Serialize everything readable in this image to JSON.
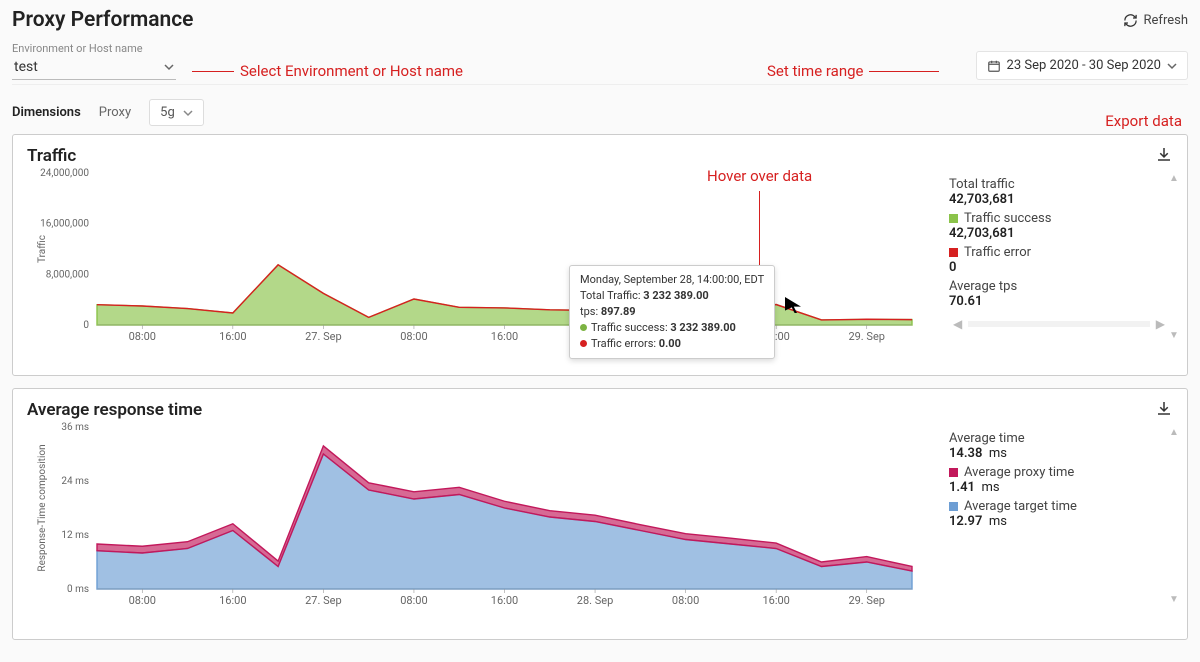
{
  "page_title": "Proxy Performance",
  "refresh_label": "Refresh",
  "env_selector": {
    "label": "Environment or Host name",
    "value": "test"
  },
  "date_range": "23 Sep 2020 - 30 Sep 2020",
  "dimensions": {
    "label": "Dimensions",
    "name": "Proxy",
    "value": "5g"
  },
  "callouts": {
    "env": "Select Environment or Host name",
    "date": "Set time range",
    "export": "Export data",
    "hover": "Hover over data"
  },
  "traffic_panel": {
    "title": "Traffic",
    "legend": {
      "total_label": "Total traffic",
      "total_value": "42,703,681",
      "success_label": "Traffic success",
      "success_value": "42,703,681",
      "error_label": "Traffic error",
      "error_value": "0",
      "avg_tps_label": "Average tps",
      "avg_tps_value": "70.61"
    },
    "tooltip": {
      "time": "Monday, September 28, 14:00:00, EDT",
      "total_label": "Total Traffic:",
      "total_value": "3 232 389.00",
      "tps_label": "tps:",
      "tps_value": "897.89",
      "success_label": "Traffic success:",
      "success_value": "3 232 389.00",
      "errors_label": "Traffic errors:",
      "errors_value": "0.00"
    }
  },
  "response_panel": {
    "title": "Average response time",
    "legend": {
      "avg_label": "Average time",
      "avg_value": "14.38",
      "avg_unit": "ms",
      "proxy_label": "Average proxy time",
      "proxy_value": "1.41",
      "proxy_unit": "ms",
      "target_label": "Average target time",
      "target_value": "12.97",
      "target_unit": "ms"
    }
  },
  "x_ticks": [
    "08:00",
    "16:00",
    "27. Sep",
    "08:00",
    "16:00",
    "28. Sep",
    "08:00",
    "16:00",
    "29. Sep"
  ],
  "chart_data": [
    {
      "type": "area",
      "title": "Traffic",
      "ylabel": "Traffic",
      "ylim": [
        0,
        24000000
      ],
      "y_ticks": [
        0,
        8000000,
        16000000,
        24000000
      ],
      "categories": [
        "26 Sep 04:00",
        "26 Sep 08:00",
        "26 Sep 12:00",
        "26 Sep 16:00",
        "26 Sep 20:00",
        "27 Sep 00:00",
        "27 Sep 04:00",
        "27 Sep 08:00",
        "27 Sep 12:00",
        "27 Sep 16:00",
        "27 Sep 20:00",
        "28 Sep 00:00",
        "28 Sep 04:00",
        "28 Sep 08:00",
        "28 Sep 12:00",
        "28 Sep 14:00",
        "28 Sep 18:00",
        "29 Sep 00:00",
        "29 Sep 04:00"
      ],
      "series": [
        {
          "name": "Traffic success",
          "color": "#8bc34a",
          "values": [
            3200000,
            3000000,
            2600000,
            1900000,
            9500000,
            5000000,
            1200000,
            4100000,
            2800000,
            2700000,
            2400000,
            2300000,
            2100000,
            2000000,
            1900000,
            3232389,
            800000,
            900000,
            850000
          ]
        },
        {
          "name": "Traffic error",
          "color": "#d62020",
          "values": [
            0,
            0,
            0,
            0,
            0,
            0,
            0,
            0,
            0,
            0,
            0,
            0,
            0,
            0,
            0,
            0,
            0,
            0,
            0
          ]
        }
      ]
    },
    {
      "type": "area",
      "title": "Average response time",
      "ylabel": "Response-Time composition",
      "ylim": [
        0,
        36
      ],
      "y_ticks": [
        0,
        12,
        24,
        36
      ],
      "y_tick_suffix": " ms",
      "categories": [
        "26 Sep 04:00",
        "26 Sep 08:00",
        "26 Sep 12:00",
        "26 Sep 16:00",
        "26 Sep 20:00",
        "27 Sep 00:00",
        "27 Sep 04:00",
        "27 Sep 08:00",
        "27 Sep 12:00",
        "27 Sep 16:00",
        "27 Sep 20:00",
        "28 Sep 00:00",
        "28 Sep 04:00",
        "28 Sep 08:00",
        "28 Sep 12:00",
        "28 Sep 16:00",
        "28 Sep 20:00",
        "29 Sep 00:00",
        "29 Sep 04:00"
      ],
      "series": [
        {
          "name": "Average target time",
          "color": "#6d9ed4",
          "values": [
            8.5,
            8,
            9,
            13,
            5,
            30,
            22,
            20,
            21,
            18,
            16,
            15,
            13,
            11,
            10,
            9,
            5,
            6,
            4
          ]
        },
        {
          "name": "Average proxy time",
          "color": "#c2185b",
          "values": [
            1.5,
            1.5,
            1.5,
            1.5,
            1.2,
            1.8,
            1.6,
            1.6,
            1.6,
            1.5,
            1.4,
            1.4,
            1.3,
            1.3,
            1.3,
            1.2,
            1.0,
            1.2,
            1.0
          ]
        }
      ]
    }
  ]
}
